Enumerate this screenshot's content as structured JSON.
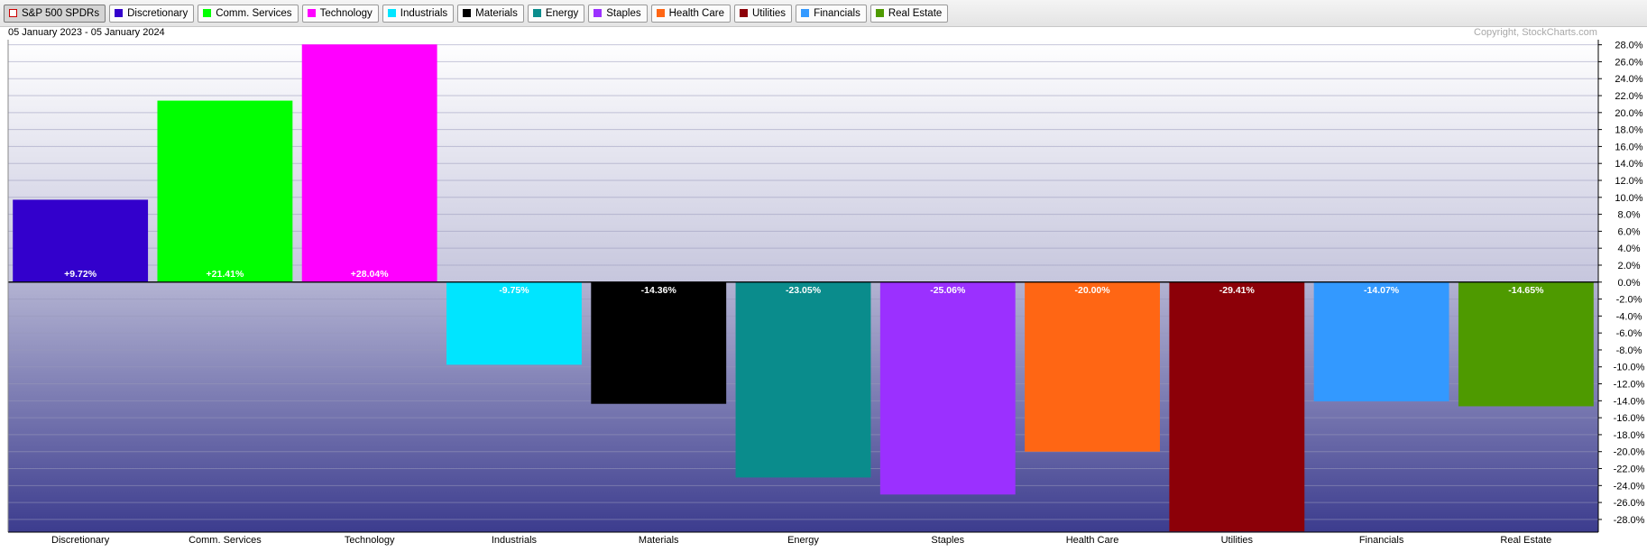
{
  "legend": [
    {
      "label": "S&P 500 SPDRs",
      "color": "#ffffff",
      "active": true
    },
    {
      "label": "Discretionary",
      "color": "#3300cc"
    },
    {
      "label": "Comm. Services",
      "color": "#00ff00"
    },
    {
      "label": "Technology",
      "color": "#ff00ff"
    },
    {
      "label": "Industrials",
      "color": "#00e5ff"
    },
    {
      "label": "Materials",
      "color": "#000000"
    },
    {
      "label": "Energy",
      "color": "#0a8c8c"
    },
    {
      "label": "Staples",
      "color": "#9b30ff"
    },
    {
      "label": "Health Care",
      "color": "#ff6614"
    },
    {
      "label": "Utilities",
      "color": "#8c0008"
    },
    {
      "label": "Financials",
      "color": "#3399ff"
    },
    {
      "label": "Real Estate",
      "color": "#4e9a00"
    }
  ],
  "header": {
    "date_range": "05 January 2023 - 05 January 2024",
    "copyright": "Copyright, StockCharts.com"
  },
  "chart_data": {
    "type": "bar",
    "categories": [
      "Discretionary",
      "Comm. Services",
      "Technology",
      "Industrials",
      "Materials",
      "Energy",
      "Staples",
      "Health Care",
      "Utilities",
      "Financials",
      "Real Estate"
    ],
    "values": [
      9.72,
      21.41,
      28.04,
      -9.75,
      -14.36,
      -23.05,
      -25.06,
      -20.0,
      -29.41,
      -14.07,
      -14.65
    ],
    "data_labels": [
      "+9.72%",
      "+21.41%",
      "+28.04%",
      "-9.75%",
      "-14.36%",
      "-23.05%",
      "-25.06%",
      "-20.00%",
      "-29.41%",
      "-14.07%",
      "-14.65%"
    ],
    "colors": [
      "#3300cc",
      "#00ff00",
      "#ff00ff",
      "#00e5ff",
      "#000000",
      "#0a8c8c",
      "#9b30ff",
      "#ff6614",
      "#8c0008",
      "#3399ff",
      "#4e9a00"
    ],
    "y_ticks": [
      28,
      26,
      24,
      22,
      20,
      18,
      16,
      14,
      12,
      10,
      8,
      6,
      4,
      2,
      0,
      -2,
      -4,
      -6,
      -8,
      -10,
      -12,
      -14,
      -16,
      -18,
      -20,
      -22,
      -24,
      -26,
      -28
    ],
    "ylim": [
      -29.5,
      28.6
    ],
    "y_axis_side": "right",
    "grid": true
  }
}
